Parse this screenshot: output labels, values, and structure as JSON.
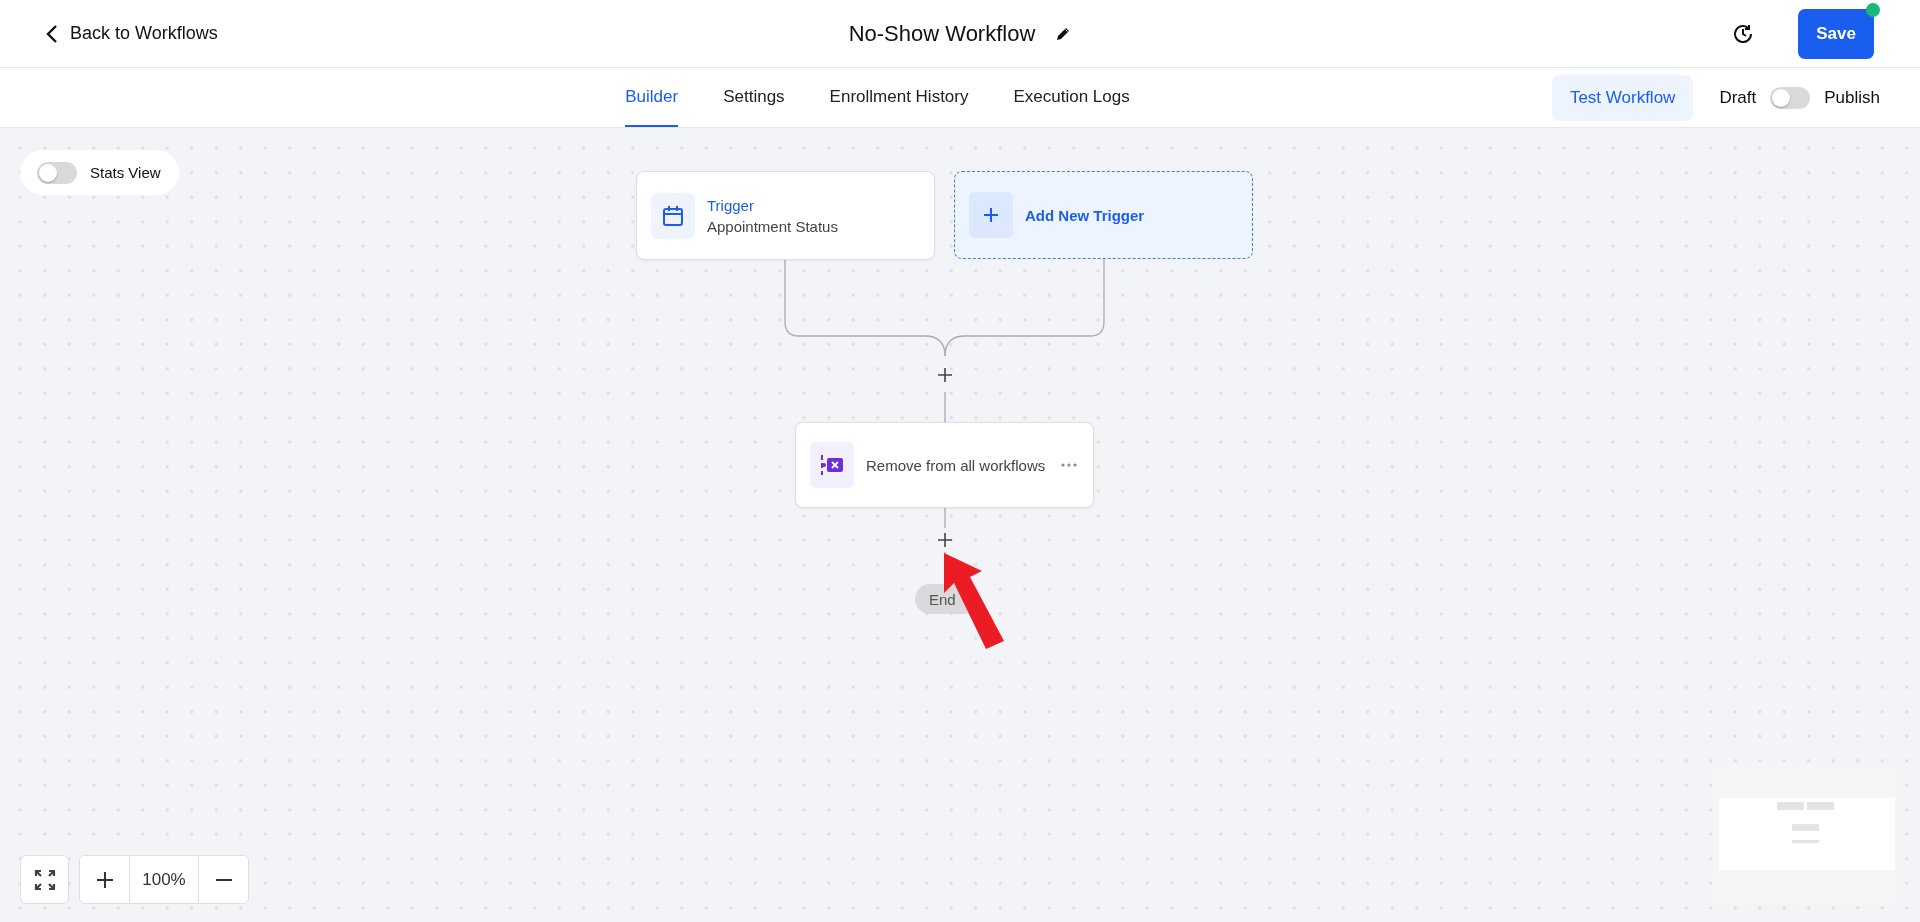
{
  "header": {
    "back_label": "Back to Workflows",
    "title": "No-Show Workflow",
    "save_label": "Save",
    "unsaved_changes": true
  },
  "tabs": [
    {
      "label": "Builder",
      "selected": true
    },
    {
      "label": "Settings",
      "selected": false
    },
    {
      "label": "Enrollment History",
      "selected": false
    },
    {
      "label": "Execution Logs",
      "selected": false
    }
  ],
  "test_button": "Test Workflow",
  "publish": {
    "off_label": "Draft",
    "on_label": "Publish",
    "on": false
  },
  "stats_view": {
    "label": "Stats View",
    "on": false
  },
  "triggers": [
    {
      "kind": "trigger",
      "title": "Trigger",
      "subtitle": "Appointment Status"
    },
    {
      "kind": "add",
      "title": "Add New Trigger"
    }
  ],
  "actions": [
    {
      "title": "Remove from all workflows"
    }
  ],
  "end_label": "End",
  "zoom": {
    "level_label": "100%"
  }
}
